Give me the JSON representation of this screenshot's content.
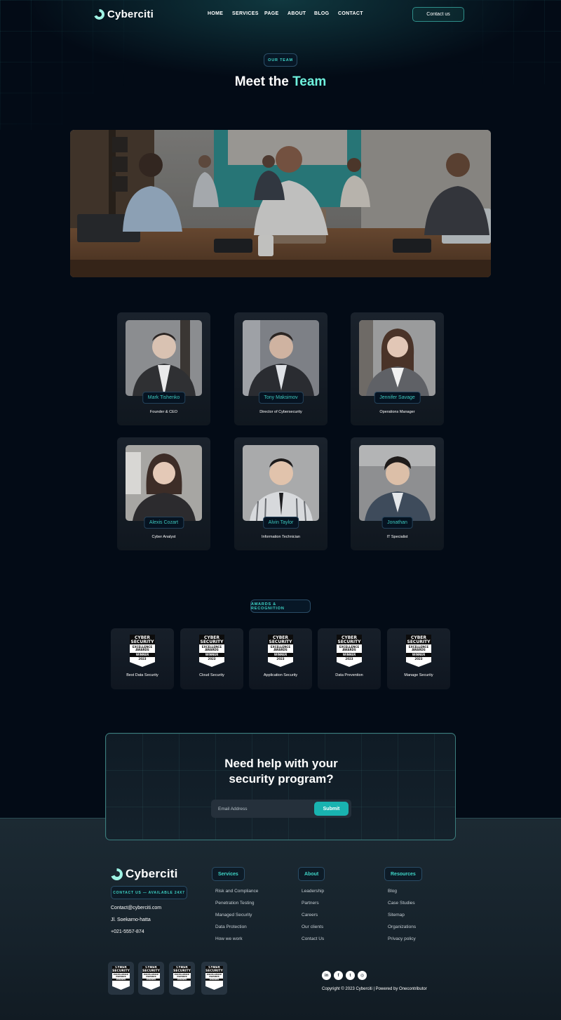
{
  "header": {
    "logo_text": "Cyberciti",
    "nav": [
      "HOME",
      "SERVICES",
      "PAGE",
      "ABOUT",
      "BLOG",
      "CONTACT"
    ],
    "contact_button": "Contact us"
  },
  "team_section": {
    "eyebrow": "OUR TEAM",
    "title_main": "Meet the ",
    "title_accent": "Team",
    "members": [
      {
        "name": "Mark Tishenko",
        "role": "Founder & CEO"
      },
      {
        "name": "Tony Maksimov",
        "role": "Director of Cybersecurity"
      },
      {
        "name": "Jennifer Savage",
        "role": "Operations Manager"
      },
      {
        "name": "Alexis Cozart",
        "role": "Cyber Analyst"
      },
      {
        "name": "Alvin Taylor",
        "role": "Information Technician"
      },
      {
        "name": "Jonathan",
        "role": "IT Specialist"
      }
    ]
  },
  "awards_section": {
    "eyebrow": "AWARDS & RECOGNITION",
    "badge": {
      "line1": "CYBER",
      "line2": "SECURITY",
      "line3": "EXCELLENCE",
      "line4": "AWARDS",
      "line5": "WINNER",
      "year": "2023"
    },
    "awards": [
      "Best Data Security",
      "Cloud Security",
      "Application Security",
      "Data Prevention",
      "Manage Security"
    ]
  },
  "cta": {
    "title_line1": "Need help with your",
    "title_line2": "security program?",
    "email_placeholder": "Email Address",
    "submit_label": "Submit"
  },
  "footer": {
    "logo_text": "Cyberciti",
    "availability": "CONTACT US — AVAILABLE 24X7",
    "email": "Contact@cyberciti.com",
    "address": "Jl. Soekarno-hatta",
    "phone": "+021-5557-874",
    "columns": [
      {
        "title": "Services",
        "links": [
          "Risk and Compliance",
          "Penetration Testing",
          "Managed Security",
          "Data Protection",
          "How we work"
        ]
      },
      {
        "title": "About",
        "links": [
          "Leadership",
          "Partners",
          "Careers",
          "Our clients",
          "Contact Us"
        ]
      },
      {
        "title": "Resources",
        "links": [
          "Blog",
          "Case Studies",
          "Sitemap",
          "Organizations",
          "Privacy policy"
        ]
      }
    ],
    "social": [
      {
        "icon": "linkedin-icon",
        "glyph": "in"
      },
      {
        "icon": "facebook-icon",
        "glyph": "f"
      },
      {
        "icon": "twitter-icon",
        "glyph": "t"
      },
      {
        "icon": "instagram-icon",
        "glyph": "◎"
      }
    ],
    "copyright": "Copyright © 2023 Cyberciti | Powered by Onecontributor"
  },
  "colors": {
    "background": "#030b16",
    "accent": "#6ff2de",
    "teal": "#3fd6c8",
    "button": "#19b3b0"
  }
}
